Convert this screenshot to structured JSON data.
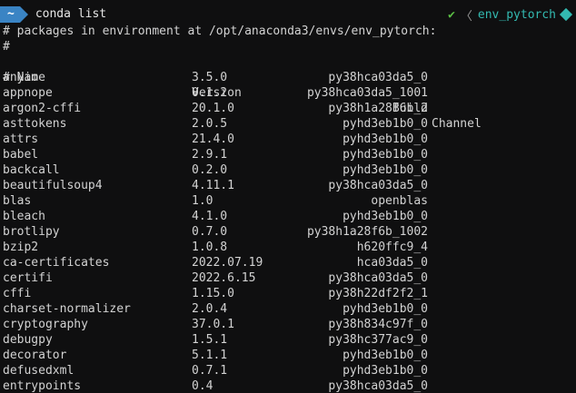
{
  "prompt": {
    "dir": "~",
    "command": "conda list",
    "status_icon": "check-icon",
    "env": "env_pytorch"
  },
  "output": {
    "header_line": "# packages in environment at /opt/anaconda3/envs/env_pytorch:",
    "hash_line": "#",
    "columns": {
      "name": "# Name",
      "version": "Version",
      "build": "Build",
      "channel": "Channel"
    },
    "packages": [
      {
        "name": "anyio",
        "version": "3.5.0",
        "build": "py38hca03da5_0"
      },
      {
        "name": "appnope",
        "version": "0.1.2",
        "build": "py38hca03da5_1001"
      },
      {
        "name": "argon2-cffi",
        "version": "20.1.0",
        "build": "py38h1a28f6b_2"
      },
      {
        "name": "asttokens",
        "version": "2.0.5",
        "build": "pyhd3eb1b0_0"
      },
      {
        "name": "attrs",
        "version": "21.4.0",
        "build": "pyhd3eb1b0_0"
      },
      {
        "name": "babel",
        "version": "2.9.1",
        "build": "pyhd3eb1b0_0"
      },
      {
        "name": "backcall",
        "version": "0.2.0",
        "build": "pyhd3eb1b0_0"
      },
      {
        "name": "beautifulsoup4",
        "version": "4.11.1",
        "build": "py38hca03da5_0"
      },
      {
        "name": "blas",
        "version": "1.0",
        "build": "openblas"
      },
      {
        "name": "bleach",
        "version": "4.1.0",
        "build": "pyhd3eb1b0_0"
      },
      {
        "name": "brotlipy",
        "version": "0.7.0",
        "build": "py38h1a28f6b_1002"
      },
      {
        "name": "bzip2",
        "version": "1.0.8",
        "build": "h620ffc9_4"
      },
      {
        "name": "ca-certificates",
        "version": "2022.07.19",
        "build": "hca03da5_0"
      },
      {
        "name": "certifi",
        "version": "2022.6.15",
        "build": "py38hca03da5_0"
      },
      {
        "name": "cffi",
        "version": "1.15.0",
        "build": "py38h22df2f2_1"
      },
      {
        "name": "charset-normalizer",
        "version": "2.0.4",
        "build": "pyhd3eb1b0_0"
      },
      {
        "name": "cryptography",
        "version": "37.0.1",
        "build": "py38h834c97f_0"
      },
      {
        "name": "debugpy",
        "version": "1.5.1",
        "build": "py38hc377ac9_0"
      },
      {
        "name": "decorator",
        "version": "5.1.1",
        "build": "pyhd3eb1b0_0"
      },
      {
        "name": "defusedxml",
        "version": "0.7.1",
        "build": "pyhd3eb1b0_0"
      },
      {
        "name": "entrypoints",
        "version": "0.4",
        "build": "py38hca03da5_0"
      }
    ]
  },
  "colors": {
    "background": "#0f0f10",
    "text": "#d3d3d3",
    "prompt_segment": "#3a84c4",
    "status_ok": "#5bbf45",
    "env_accent": "#33b9b0"
  }
}
